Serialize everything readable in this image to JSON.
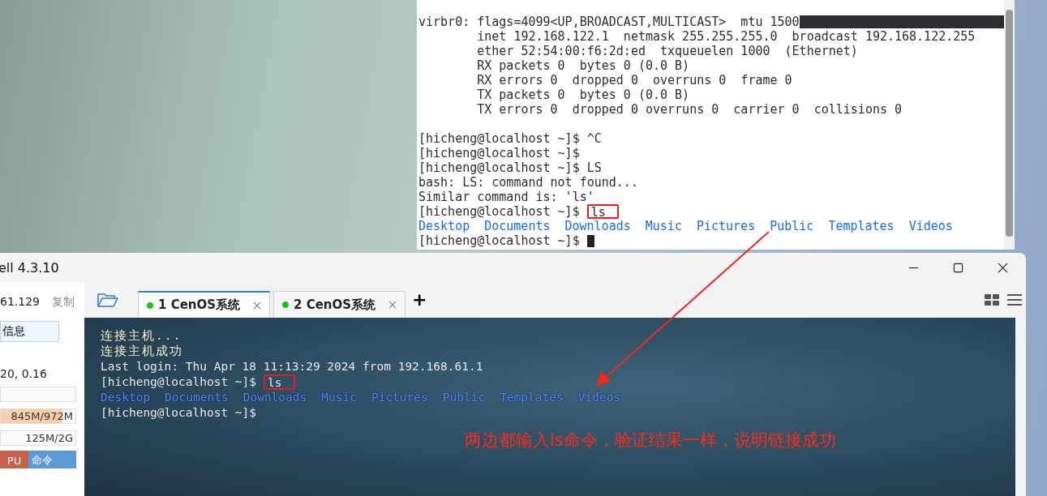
{
  "top_terminal": {
    "lines": [
      {
        "kind": "redacted",
        "text": "virbr0: flags=4099<UP,BROADCAST,MULTICAST>  mtu 1500"
      },
      {
        "kind": "text",
        "text": "        inet 192.168.122.1  netmask 255.255.255.0  broadcast 192.168.122.255"
      },
      {
        "kind": "text",
        "text": "        ether 52:54:00:f6:2d:ed  txqueuelen 1000  (Ethernet)"
      },
      {
        "kind": "text",
        "text": "        RX packets 0  bytes 0 (0.0 B)"
      },
      {
        "kind": "text",
        "text": "        RX errors 0  dropped 0  overruns 0  frame 0"
      },
      {
        "kind": "text",
        "text": "        TX packets 0  bytes 0 (0.0 B)"
      },
      {
        "kind": "text",
        "text": "        TX errors 0  dropped 0 overruns 0  carrier 0  collisions 0"
      },
      {
        "kind": "blank"
      },
      {
        "kind": "text",
        "text": "[hicheng@localhost ~]$ ^C"
      },
      {
        "kind": "text",
        "text": "[hicheng@localhost ~]$"
      },
      {
        "kind": "text",
        "text": "[hicheng@localhost ~]$ LS"
      },
      {
        "kind": "text",
        "text": "bash: LS: command not found..."
      },
      {
        "kind": "text",
        "text": "Similar command is: 'ls'"
      },
      {
        "kind": "boxed",
        "text": "[hicheng@localhost ~]$",
        "command": "ls"
      },
      {
        "kind": "listing",
        "items": [
          "Desktop",
          "Documents",
          "Downloads",
          "Music",
          "Pictures",
          "Public",
          "Templates",
          "Videos"
        ]
      },
      {
        "kind": "cursor",
        "text": "[hicheng@localhost ~]$"
      }
    ]
  },
  "shell_window": {
    "title": "ell 4.3.10",
    "side_panel": {
      "host": "61.129",
      "copy": "复制",
      "info_button": "信息",
      "load": "20, 0.16",
      "memory": {
        "reading": "845M/972M",
        "level": 0.83
      },
      "swap": {
        "reading": "125M/2G"
      },
      "tabs": [
        {
          "label": "PU",
          "color": "#c8604c"
        },
        {
          "label": "命令",
          "color": "#5b9bd5"
        }
      ]
    },
    "tabs": [
      {
        "label": "1 CenOS系统",
        "selected": true,
        "connected": true
      },
      {
        "label": "2 CenOS系统",
        "selected": false,
        "connected": true
      }
    ],
    "add_tab": "+",
    "terminal": {
      "lines": [
        {
          "kind": "info",
          "text": "连接主机..."
        },
        {
          "kind": "info",
          "text": "连接主机成功"
        },
        {
          "kind": "text",
          "text": "Last login: Thu Apr 18 11:13:29 2024 from 192.168.61.1"
        },
        {
          "kind": "boxed",
          "text": "[hicheng@localhost ~]$",
          "command": "ls"
        },
        {
          "kind": "listing",
          "items": [
            "Desktop",
            "Documents",
            "Downloads",
            "Music",
            "Pictures",
            "Public",
            "Templates",
            "Videos"
          ]
        },
        {
          "kind": "text",
          "text": "[hicheng@localhost ~]$"
        }
      ]
    },
    "annotation": "两边都输入ls命令，验证结果一样，说明链接成功"
  }
}
